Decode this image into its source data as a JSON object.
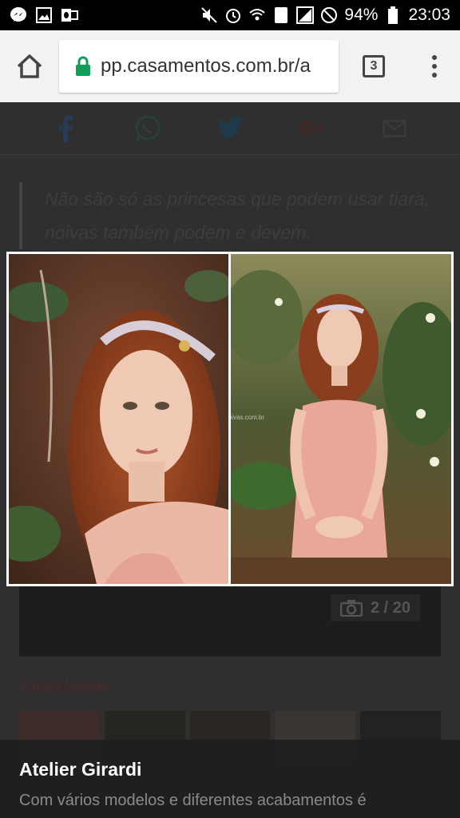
{
  "status_bar": {
    "battery": "94%",
    "time": "23:03",
    "sim_slot": "1",
    "icons": [
      "messenger-icon",
      "gallery-icon",
      "outlook-icon",
      "mute-icon",
      "alarm-icon",
      "wifi-icon",
      "sim-icon",
      "no-signal-icon",
      "blocked-icon",
      "battery-icon"
    ]
  },
  "browser": {
    "url": "pp.casamentos.com.br/a",
    "tab_count": "3"
  },
  "share": {
    "icons": [
      "facebook-icon",
      "whatsapp-icon",
      "twitter-icon",
      "googleplus-icon",
      "email-icon"
    ],
    "googleplus_label": "G+"
  },
  "article": {
    "quote": "Não são só as princesas que podem usar tiara, noivas também podem e devem.",
    "gallery_counter": "2 / 20",
    "credit_link": "Zatara Noivas"
  },
  "lightbox": {
    "watermark": "zataranoivas.com.br"
  },
  "caption": {
    "title": "Atelier Girardi",
    "text": "Com vários modelos e diferentes acabamentos é"
  },
  "colors": {
    "lock_green": "#0f9d58",
    "status_bg": "#000000",
    "toolbar_bg": "#f2f2f2",
    "dress_pink": "#e9a79a"
  }
}
